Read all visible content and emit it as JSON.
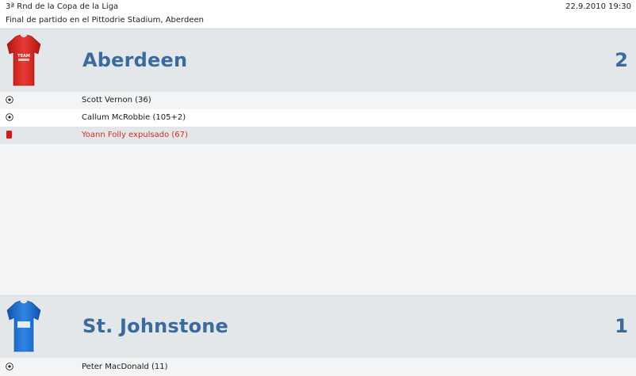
{
  "header": {
    "competition": "3ª Rnd de la Copa de la Liga",
    "datetime": "22.9.2010 19:30",
    "result_line": "Final de partido en el Pittodrie Stadium, Aberdeen"
  },
  "home": {
    "name": "Aberdeen",
    "score": "2",
    "shirt_color": "#e02b24",
    "shirt_text": "TEAM",
    "events": [
      {
        "type": "goal-icon",
        "text": "Scott Vernon (36)"
      },
      {
        "type": "goal-icon",
        "text": "Callum McRobbie (105+2)"
      },
      {
        "type": "red-card-icon",
        "text": "Yoann Folly expulsado (67)"
      }
    ]
  },
  "away": {
    "name": "St. Johnstone",
    "score": "1",
    "shirt_color": "#1f6fd1",
    "events": [
      {
        "type": "goal-icon",
        "text": "Peter MacDonald (11)"
      }
    ]
  },
  "colors": {
    "team_name": "#3a6a9e",
    "red_card": "#d11a1a",
    "sent_off_text": "#d52b1e"
  }
}
